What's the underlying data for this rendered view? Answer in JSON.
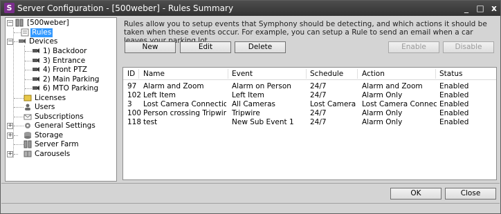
{
  "window": {
    "title": "Server Configuration - [500weber] - Rules Summary",
    "app_icon_letter": "S",
    "controls": {
      "minimize": "_",
      "maximize": "□",
      "close": "x"
    }
  },
  "tree": {
    "root": "[500weber]",
    "rules": "Rules",
    "devices": "Devices",
    "device_items": [
      "1) Backdoor",
      "3) Entrance",
      "4) Front PTZ",
      "2) Main Parking",
      "6) MTO Parking"
    ],
    "licenses": "Licenses",
    "users": "Users",
    "subscriptions": "Subscriptions",
    "general_settings": "General Settings",
    "storage": "Storage",
    "server_farm": "Server Farm",
    "carousels": "Carousels"
  },
  "main": {
    "description": "Rules allow you to setup events that Symphony should be detecting, and which actions it should be taken when these events occur.  For example, you can setup a Rule to send an email when a car leaves your parking lot.",
    "buttons": {
      "new": "New",
      "edit": "Edit",
      "delete": "Delete",
      "enable": "Enable",
      "disable": "Disable"
    },
    "columns": [
      "ID",
      "Name",
      "Event",
      "Schedule",
      "Action",
      "Status"
    ],
    "rows": [
      [
        "97",
        "Alarm and Zoom",
        "Alarm on Person",
        "24/7",
        "Alarm and Zoom",
        "Enabled"
      ],
      [
        "102",
        "Left Item",
        "Left Item",
        "24/7",
        "Alarm Only",
        "Enabled"
      ],
      [
        "3",
        "Lost Camera Connection",
        "All Cameras",
        "Lost Camera Co...",
        "Lost Camera Connection A...",
        "Enabled"
      ],
      [
        "100",
        "Person crossing Tripwire",
        "Tripwire",
        "24/7",
        "Alarm Only",
        "Enabled"
      ],
      [
        "118",
        "test",
        "New Sub Event 1",
        "24/7",
        "Alarm Only",
        "Enabled"
      ]
    ]
  },
  "footer": {
    "ok": "OK",
    "close": "Close"
  }
}
